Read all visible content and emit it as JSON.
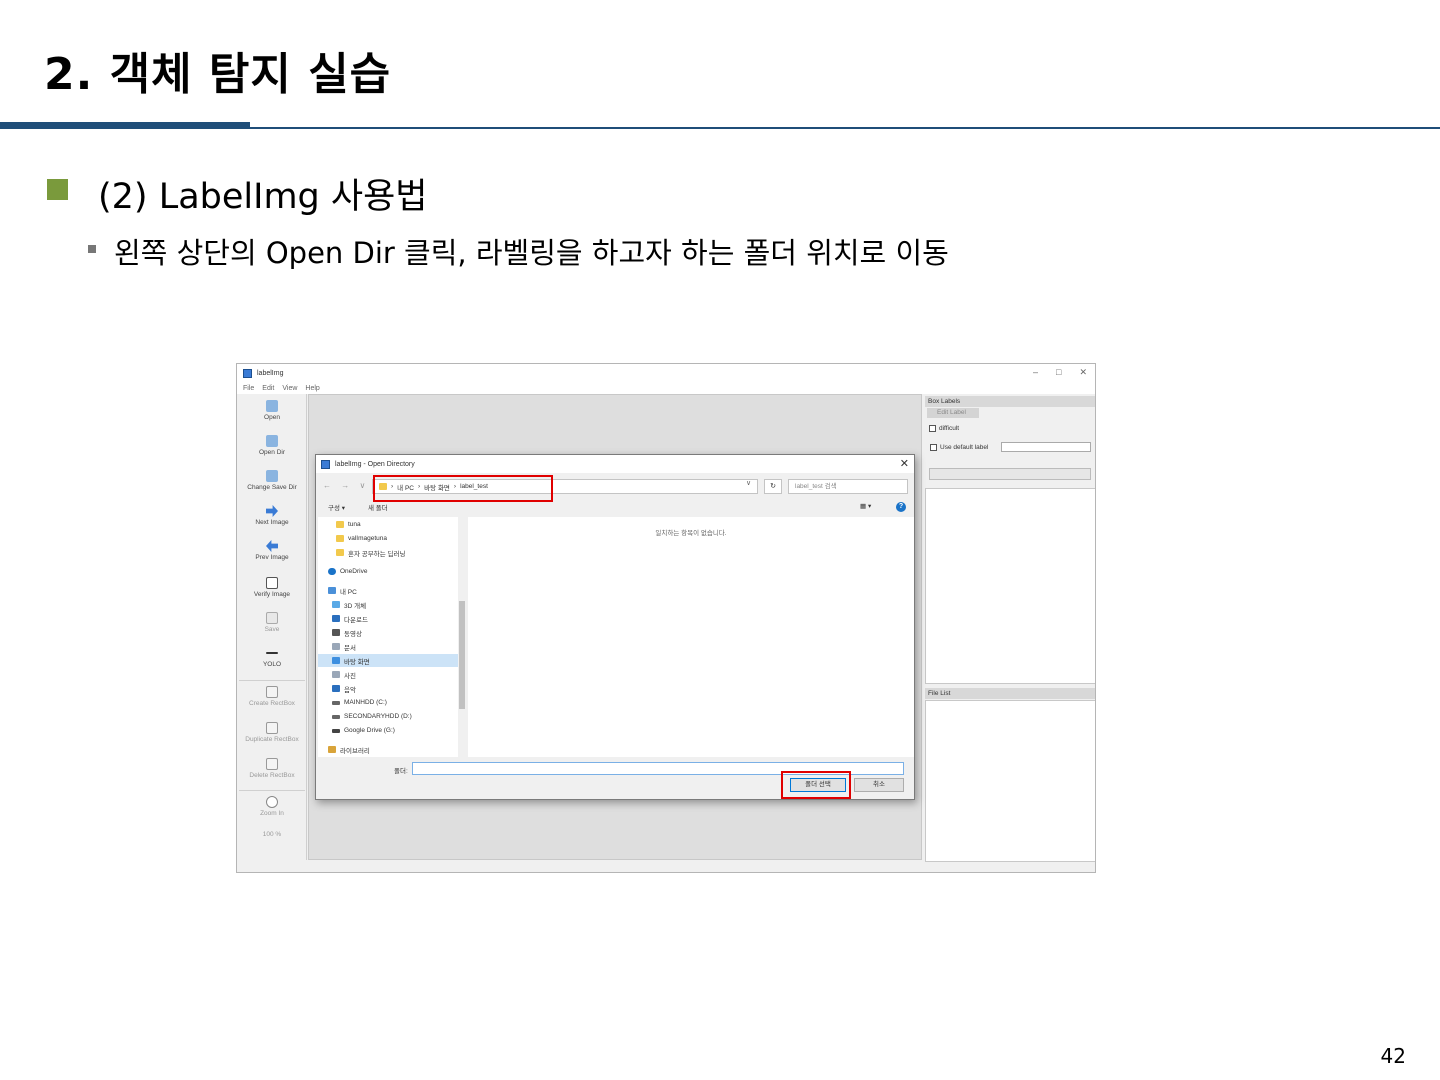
{
  "slide": {
    "title": "2. 객체 탐지 실습",
    "section": "(2) LabelImg 사용법",
    "instruction": "왼쪽 상단의 Open Dir 클릭, 라벨링을 하고자 하는 폴더 위치로 이동",
    "page_number": "42"
  },
  "colors": {
    "title_rule": "#1f4e79",
    "bullet_green": "#7a9a3c",
    "highlight_red": "#e00000"
  },
  "app": {
    "title": "labelImg",
    "window_controls": [
      "–",
      "□",
      "✕"
    ],
    "menu": [
      "File",
      "Edit",
      "View",
      "Help"
    ],
    "toolbar": [
      {
        "label": "Open",
        "icon": "open-icon"
      },
      {
        "label": "Open Dir",
        "icon": "open-dir-icon"
      },
      {
        "label": "Change Save Dir",
        "icon": "change-save-dir-icon"
      },
      {
        "label": "Next Image",
        "icon": "next-image-icon"
      },
      {
        "label": "Prev Image",
        "icon": "prev-image-icon"
      },
      {
        "label": "Verify Image",
        "icon": "verify-image-icon"
      },
      {
        "label": "Save",
        "icon": "save-icon"
      },
      {
        "label": "YOLO",
        "icon": "yolo-icon"
      },
      {
        "label": "Create RectBox",
        "icon": "create-rectbox-icon"
      },
      {
        "label": "Duplicate RectBox",
        "icon": "duplicate-rectbox-icon"
      },
      {
        "label": "Delete RectBox",
        "icon": "delete-rectbox-icon"
      },
      {
        "label": "Zoom In",
        "icon": "zoom-in-icon"
      },
      {
        "label": "100 %",
        "icon": ""
      }
    ],
    "right_dock": {
      "box_labels_title": "Box Labels",
      "edit_label": "Edit Label",
      "difficult": "difficult",
      "use_default_label": "Use default label",
      "file_list_title": "File List"
    }
  },
  "dialog": {
    "title": "labelImg - Open Directory",
    "close": "✕",
    "nav": "← → ∨ ↑",
    "breadcrumb": [
      "내 PC",
      "바탕 화면",
      "label_test"
    ],
    "refresh": "↻",
    "search_placeholder": "label_test 검색",
    "organize": "구성 ▾",
    "new_folder": "새 폴더",
    "view_toggle": "▦ ▾",
    "help": "?",
    "tree": [
      {
        "label": "tuna",
        "icon": "folder-icon",
        "color": "#f2c94c"
      },
      {
        "label": "valImagetuna",
        "icon": "folder-icon",
        "color": "#f2c94c"
      },
      {
        "label": "혼자 공부하는 딥러닝",
        "icon": "folder-icon",
        "color": "#f2c94c"
      },
      {
        "label": "OneDrive",
        "icon": "onedrive-icon",
        "color": "#1a73c8"
      },
      {
        "label": "내 PC",
        "icon": "pc-icon",
        "color": "#4a90d9"
      },
      {
        "label": "3D 개체",
        "icon": "3d-objects-icon",
        "color": "#5aa9e6"
      },
      {
        "label": "다운로드",
        "icon": "download-icon",
        "color": "#2a6fbe"
      },
      {
        "label": "동영상",
        "icon": "video-icon",
        "color": "#555555"
      },
      {
        "label": "문서",
        "icon": "document-icon",
        "color": "#9aa7b8"
      },
      {
        "label": "바탕 화면",
        "icon": "desktop-icon",
        "color": "#3d8fe0",
        "selected": true
      },
      {
        "label": "사진",
        "icon": "pictures-icon",
        "color": "#9aa7b8"
      },
      {
        "label": "음악",
        "icon": "music-icon",
        "color": "#2a6fbe"
      },
      {
        "label": "MAINHDD (C:)",
        "icon": "drive-icon",
        "color": "#666666"
      },
      {
        "label": "SECONDARYHDD (D:)",
        "icon": "drive-icon",
        "color": "#666666"
      },
      {
        "label": "Google Drive (G:)",
        "icon": "drive-icon",
        "color": "#444444"
      },
      {
        "label": "라이브러리",
        "icon": "library-icon",
        "color": "#d9a43a"
      }
    ],
    "empty_message": "일치하는 항목이 없습니다.",
    "folder_label": "폴더:",
    "select_folder": "폴더 선택",
    "cancel": "취소"
  }
}
